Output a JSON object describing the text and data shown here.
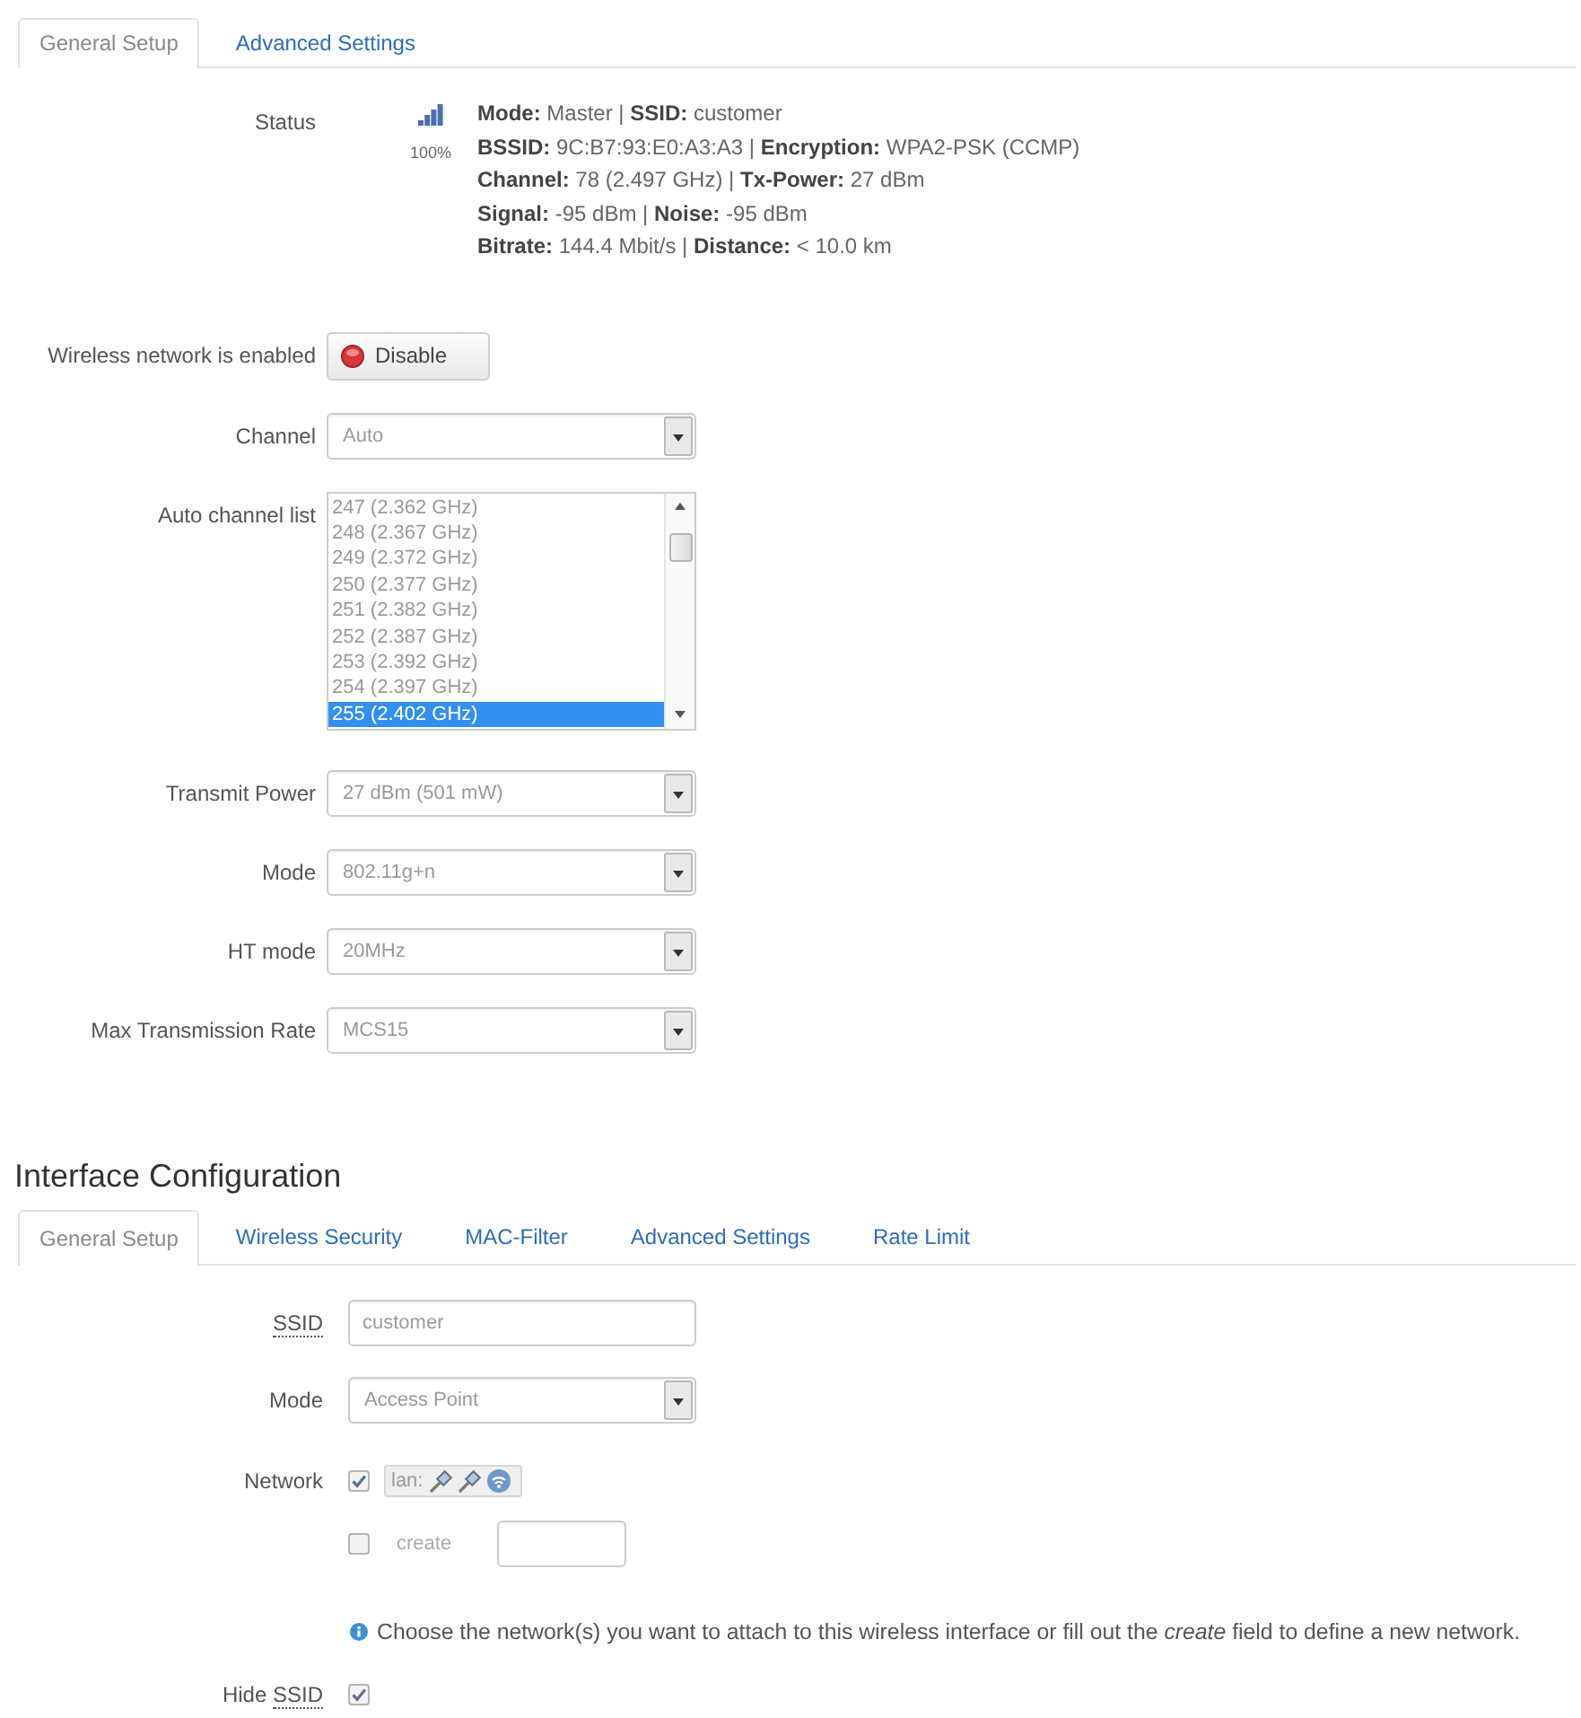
{
  "radio_tabs": [
    {
      "label": "General Setup",
      "selected": true
    },
    {
      "label": "Advanced Settings",
      "selected": false
    }
  ],
  "radio_form": {
    "status": {
      "label": "Status",
      "signal_quality": "100%",
      "lines": [
        "**Mode:** Master | **SSID:** customer",
        "**BSSID:** 9C:B7:93:E0:A3:A3 | **Encryption:** WPA2-PSK (CCMP)",
        "**Channel:** 78 (2.497 GHz) | **Tx-Power:** 27 dBm",
        "**Signal:** -95 dBm | **Noise:** -95 dBm",
        "**Bitrate:** 144.4 Mbit/s | **Distance:** < 10.0 km"
      ]
    },
    "fields": [
      {
        "kind": "button",
        "label": "Wireless network is enabled",
        "button": "Disable"
      },
      {
        "kind": "select",
        "label": "Channel",
        "value": "Auto"
      },
      {
        "kind": "listbox",
        "label": "Auto channel list",
        "options": [
          {
            "label": "247 (2.362 GHz)",
            "selected": false
          },
          {
            "label": "248 (2.367 GHz)",
            "selected": false
          },
          {
            "label": "249 (2.372 GHz)",
            "selected": false
          },
          {
            "label": "250 (2.377 GHz)",
            "selected": false
          },
          {
            "label": "251 (2.382 GHz)",
            "selected": false
          },
          {
            "label": "252 (2.387 GHz)",
            "selected": false
          },
          {
            "label": "253 (2.392 GHz)",
            "selected": false
          },
          {
            "label": "254 (2.397 GHz)",
            "selected": false
          },
          {
            "label": "255 (2.402 GHz)",
            "selected": true
          }
        ]
      },
      {
        "kind": "select",
        "label": "Transmit Power",
        "value": "27 dBm (501 mW)"
      },
      {
        "kind": "select",
        "label": "Mode",
        "value": "802.11g+n"
      },
      {
        "kind": "select",
        "label": "HT mode",
        "value": "20MHz"
      },
      {
        "kind": "select",
        "label": "Max Transmission Rate",
        "value": "MCS15"
      }
    ]
  },
  "interface": {
    "title": "Interface Configuration",
    "tabs": [
      {
        "label": "General Setup",
        "selected": true
      },
      {
        "label": "Wireless Security",
        "selected": false
      },
      {
        "label": "MAC-Filter",
        "selected": false
      },
      {
        "label": "Advanced Settings",
        "selected": false
      },
      {
        "label": "Rate Limit",
        "selected": false
      }
    ],
    "fields": [
      {
        "kind": "text",
        "label": [
          {
            "text": "SSID",
            "underlined": true
          }
        ],
        "value": "customer"
      },
      {
        "kind": "select",
        "label": [
          {
            "text": "Mode",
            "underlined": false
          }
        ],
        "value": "Access Point"
      },
      {
        "kind": "network",
        "label": [
          {
            "text": "Network",
            "underlined": false
          }
        ],
        "networks": [
          {
            "name": "lan:",
            "checked": true,
            "devices": [
              {
                "kind": "ethernet"
              },
              {
                "kind": "ethernet"
              },
              {
                "kind": "wireless"
              }
            ]
          }
        ],
        "create": {
          "label": "create",
          "checked": false
        },
        "hint": "Choose the network(s) you want to attach to this wireless interface or fill out the *create* field to define a new network."
      },
      {
        "kind": "checkbox",
        "label": [
          {
            "text": "Hide",
            "underlined": false
          },
          {
            "text": "SSID",
            "underlined": true
          }
        ],
        "checked": true
      }
    ]
  }
}
